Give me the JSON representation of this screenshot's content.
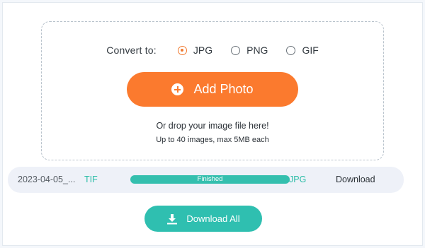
{
  "converter": {
    "convert_label": "Convert to:",
    "formats": [
      {
        "label": "JPG",
        "selected": true
      },
      {
        "label": "PNG",
        "selected": false
      },
      {
        "label": "GIF",
        "selected": false
      }
    ],
    "add_button_label": "Add Photo",
    "drop_hint": "Or drop your image file here!",
    "limit_hint": "Up to 40 images, max 5MB each"
  },
  "files": [
    {
      "name": "2023-04-05_...",
      "source_format": "TIF",
      "status": "Finished",
      "progress": 1.0,
      "target_format": "JPG",
      "action_label": "Download"
    }
  ],
  "download_all_label": "Download All",
  "colors": {
    "accent_orange": "#fb7a2e",
    "accent_teal": "#2fbfb0",
    "format_text": "#2bbda7",
    "row_background": "#eef1f8"
  },
  "icons": {
    "add": "plus-circle-icon",
    "download_all": "download-icon"
  }
}
